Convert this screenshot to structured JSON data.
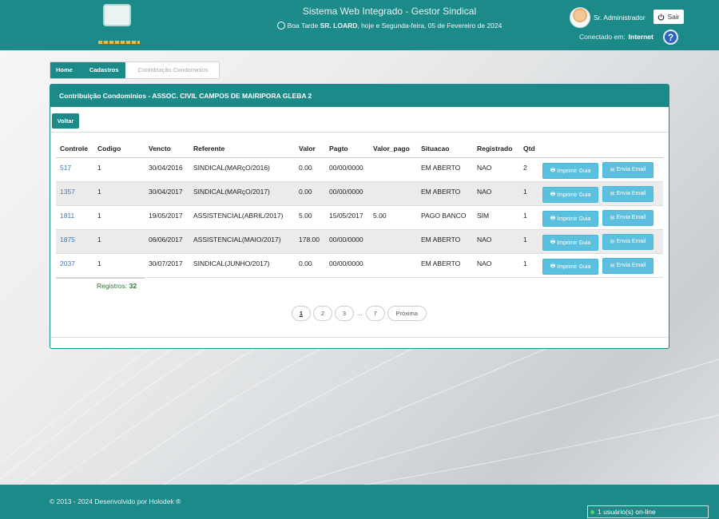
{
  "header": {
    "title": "Sistema Web Integrado - Gestor Sindical",
    "greeting_prefix": "Boa Tarde",
    "greeting_name": "SR. LOARD",
    "greeting_suffix": ", hoje e Segunda-feira, 05 de Fevereiro de 2024",
    "user_name": "Sr. Administrador",
    "logout_label": "Sair",
    "connected_label": "Conectado em:",
    "connected_value": "Internet",
    "help_label": "?"
  },
  "breadcrumb": [
    "Home",
    "Cadastros",
    "Contribuição Condominios"
  ],
  "panel": {
    "title": "Contribuição Condominios - ASSOC. CIVIL CAMPOS DE MAIRIPORA GLEBA 2",
    "back_label": "Voltar"
  },
  "table": {
    "columns": [
      "Controle",
      "Codigo",
      "Vencto",
      "Referente",
      "Valor",
      "Pagto",
      "Valor_pago",
      "Situacao",
      "Registrado",
      "Qtd"
    ],
    "rows": [
      {
        "controle": "517",
        "codigo": "1",
        "vencto": "30/04/2016",
        "referente": "SINDICAL(MARçO/2016)",
        "valor": "0.00",
        "pagto": "00/00/0000",
        "valor_pago": "",
        "situacao": "EM ABERTO",
        "registrado": "NAO",
        "qtd": "2"
      },
      {
        "controle": "1357",
        "codigo": "1",
        "vencto": "30/04/2017",
        "referente": "SINDICAL(MARçO/2017)",
        "valor": "0.00",
        "pagto": "00/00/0000",
        "valor_pago": "",
        "situacao": "EM ABERTO",
        "registrado": "NAO",
        "qtd": "1"
      },
      {
        "controle": "1811",
        "codigo": "1",
        "vencto": "19/05/2017",
        "referente": "ASSISTENCIAL(ABRIL/2017)",
        "valor": "5.00",
        "pagto": "15/05/2017",
        "valor_pago": "5.00",
        "situacao": "PAGO BANCO",
        "registrado": "SIM",
        "qtd": "1"
      },
      {
        "controle": "1875",
        "codigo": "1",
        "vencto": "06/06/2017",
        "referente": "ASSISTENCIAL(MAIO/2017)",
        "valor": "178.00",
        "pagto": "00/00/0000",
        "valor_pago": "",
        "situacao": "EM ABERTO",
        "registrado": "NAO",
        "qtd": "1"
      },
      {
        "controle": "2037",
        "codigo": "1",
        "vencto": "30/07/2017",
        "referente": "SINDICAL(JUNHO/2017)",
        "valor": "0.00",
        "pagto": "00/00/0000",
        "valor_pago": "",
        "situacao": "EM ABERTO",
        "registrado": "NAO",
        "qtd": "1"
      }
    ],
    "print_label": "Imprimir Guia",
    "email_label": "Envia Email"
  },
  "registros": {
    "label": "Registros:",
    "count": "32"
  },
  "pagination": {
    "pages": [
      "1",
      "2",
      "3"
    ],
    "ellipsis": "...",
    "last": "7",
    "next_label": "Próxima",
    "current": "1"
  },
  "footer": {
    "copyright": "© 2013 - 2024 Desenvolvido por Holodek ®",
    "online": "1 usuário(s) on-line"
  },
  "colors": {
    "primary": "#1d8a8a",
    "info_button": "#5bc0de",
    "link": "#3a7ab8"
  }
}
